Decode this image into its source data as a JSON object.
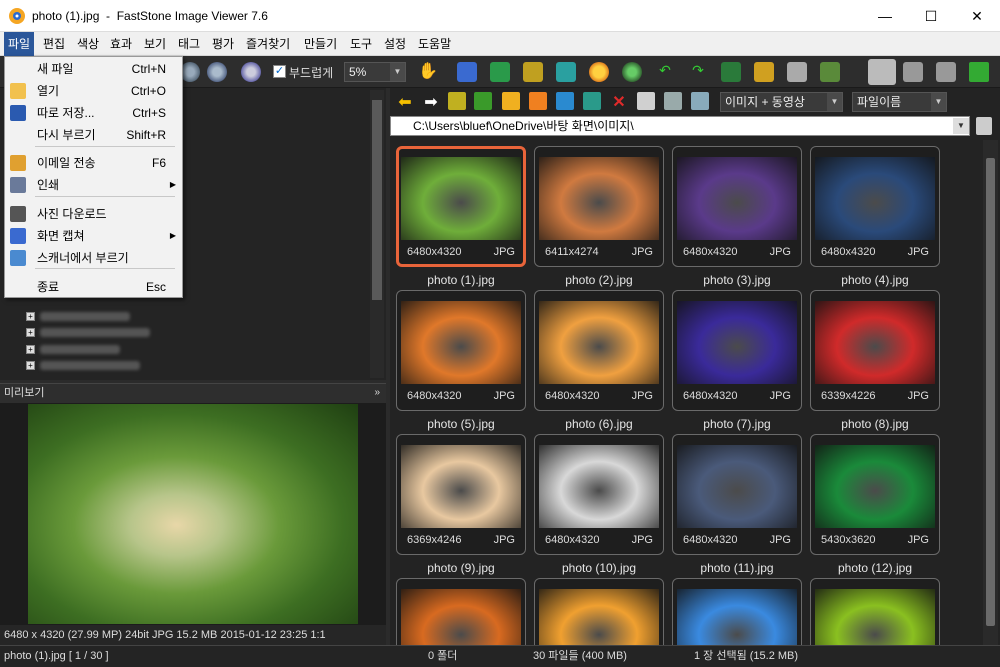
{
  "window": {
    "title": "photo (1).jpg  -  FastStone Image Viewer 7.6",
    "minimize": "—",
    "maximize": "☐",
    "close": "✕"
  },
  "menu": [
    "파일",
    "편집",
    "색상",
    "효과",
    "보기",
    "태그",
    "평가",
    "즐겨찾기",
    "만들기",
    "도구",
    "설정",
    "도움말"
  ],
  "file_menu": [
    {
      "label": "새 파일",
      "shortcut": "Ctrl+N",
      "icon": "",
      "submenu": false
    },
    {
      "label": "열기",
      "shortcut": "Ctrl+O",
      "icon": "open-icon",
      "submenu": false
    },
    {
      "label": "따로 저장...",
      "shortcut": "Ctrl+S",
      "icon": "save-icon",
      "submenu": false
    },
    {
      "label": "다시 부르기",
      "shortcut": "Shift+R",
      "icon": "",
      "submenu": false
    },
    {
      "label": "이메일 전송",
      "shortcut": "F6",
      "icon": "email-icon",
      "submenu": false
    },
    {
      "label": "인쇄",
      "shortcut": "",
      "icon": "print-icon",
      "submenu": true
    },
    {
      "label": "사진 다운로드",
      "shortcut": "",
      "icon": "camera-icon",
      "submenu": false
    },
    {
      "label": "화면 캡쳐",
      "shortcut": "",
      "icon": "capture-icon",
      "submenu": true
    },
    {
      "label": "스캐너에서 부르기",
      "shortcut": "",
      "icon": "scanner-icon",
      "submenu": false
    },
    {
      "label": "종료",
      "shortcut": "Esc",
      "icon": "",
      "submenu": false
    }
  ],
  "toolbar": {
    "smooth_label": "부드럽게",
    "zoom_value": "5%",
    "filter_value": "이미지 + 동영상",
    "sort_value": "파일이름"
  },
  "path": "C:\\Users\\bluef\\OneDrive\\바탕 화면\\이미지\\",
  "preview": {
    "header": "미리보기",
    "info": "6480 x 4320 (27.99 MP)  24bit  JPG  15.2 MB  2015-01-12 23:25  1:1"
  },
  "thumbnails": [
    {
      "name": "photo (1).jpg",
      "dims": "6480x4320",
      "ext": "JPG",
      "selected": true,
      "color": "#6fae3a"
    },
    {
      "name": "photo (2).jpg",
      "dims": "6411x4274",
      "ext": "JPG",
      "selected": false,
      "color": "#d07a40"
    },
    {
      "name": "photo (3).jpg",
      "dims": "6480x4320",
      "ext": "JPG",
      "selected": false,
      "color": "#5a3a8a"
    },
    {
      "name": "photo (4).jpg",
      "dims": "6480x4320",
      "ext": "JPG",
      "selected": false,
      "color": "#2a4a7a"
    },
    {
      "name": "photo (5).jpg",
      "dims": "6480x4320",
      "ext": "JPG",
      "selected": false,
      "color": "#e0782a"
    },
    {
      "name": "photo (6).jpg",
      "dims": "6480x4320",
      "ext": "JPG",
      "selected": false,
      "color": "#f0a040"
    },
    {
      "name": "photo (7).jpg",
      "dims": "6480x4320",
      "ext": "JPG",
      "selected": false,
      "color": "#3a2a9a"
    },
    {
      "name": "photo (8).jpg",
      "dims": "6339x4226",
      "ext": "JPG",
      "selected": false,
      "color": "#d02a2a"
    },
    {
      "name": "photo (9).jpg",
      "dims": "6369x4246",
      "ext": "JPG",
      "selected": false,
      "color": "#e8c8a0"
    },
    {
      "name": "photo (10).jpg",
      "dims": "6480x4320",
      "ext": "JPG",
      "selected": false,
      "color": "#d8d8d8"
    },
    {
      "name": "photo (11).jpg",
      "dims": "6480x4320",
      "ext": "JPG",
      "selected": false,
      "color": "#4a5a7a"
    },
    {
      "name": "photo (12).jpg",
      "dims": "5430x3620",
      "ext": "JPG",
      "selected": false,
      "color": "#1a8a3a"
    },
    {
      "name": "",
      "dims": "",
      "ext": "",
      "selected": false,
      "color": "#d86a20"
    },
    {
      "name": "",
      "dims": "",
      "ext": "",
      "selected": false,
      "color": "#f0a030"
    },
    {
      "name": "",
      "dims": "",
      "ext": "",
      "selected": false,
      "color": "#3a8ae0"
    },
    {
      "name": "",
      "dims": "",
      "ext": "",
      "selected": false,
      "color": "#8ac020"
    }
  ],
  "status": {
    "file": "photo (1).jpg [ 1 / 30 ]",
    "folders": "0 폴더",
    "files": "30 파일들 (400 MB)",
    "selected": "1 장 선택됨 (15.2 MB)"
  }
}
